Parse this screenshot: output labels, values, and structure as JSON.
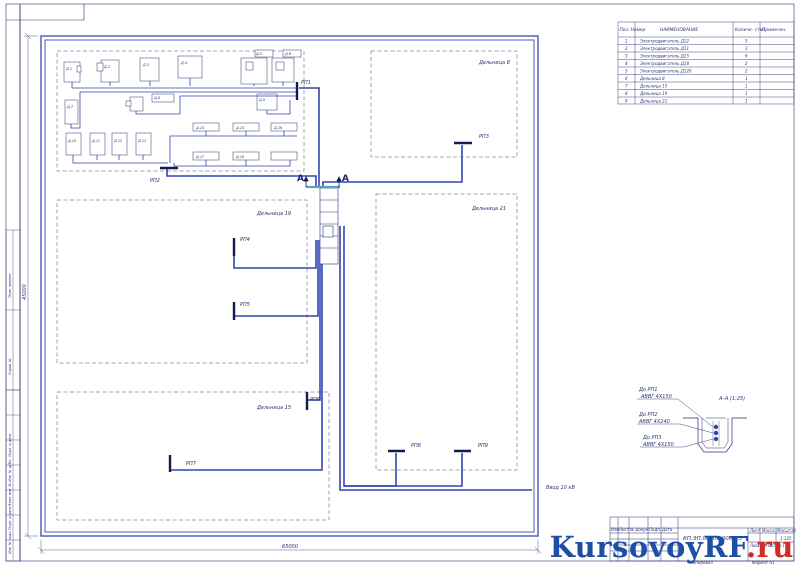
{
  "zones": {
    "z8": "Дельница 8",
    "z19": "Дельница 19",
    "z21": "Дельница 21",
    "z15": "Дельница 15"
  },
  "dist_points": {
    "rp1": "РП1",
    "rp2": "РП2",
    "rp3": "РП3",
    "rp4": "РП4",
    "rp5": "РП5",
    "rp6": "РП6",
    "rp7": "РП7",
    "rp8": "РП8",
    "rp9": "РП9"
  },
  "section_mark": "А",
  "input_label": "Ввод 10 кВ",
  "dimensions": {
    "width": "65000",
    "height": "45000"
  },
  "legend": {
    "headers": [
      "Поз. Номер",
      "НАИМЕНОВАНИЕ",
      "Количе- ство",
      "Примечан."
    ],
    "rows": [
      [
        "1",
        "Электродвигатель Д12",
        "5",
        ""
      ],
      [
        "2",
        "Электродвигатель Д11",
        "3",
        ""
      ],
      [
        "3",
        "Электродвигатель Д15",
        "6",
        ""
      ],
      [
        "4",
        "Электродвигатель Д18",
        "2",
        ""
      ],
      [
        "5",
        "Электродвигатель Д120",
        "2",
        ""
      ],
      [
        "6",
        "Дельница 8",
        "1",
        ""
      ],
      [
        "7",
        "Дельница 15",
        "1",
        ""
      ],
      [
        "8",
        "Дельница 19",
        "1",
        ""
      ],
      [
        "9",
        "Дельница 21",
        "1",
        ""
      ]
    ]
  },
  "section": {
    "title": "А–А (1:25)",
    "cables": [
      {
        "to": "До РП1",
        "cable": "АВВГ 4Х150"
      },
      {
        "to": "До РП2",
        "cable": "АВВГ 4Х240"
      },
      {
        "to": "До РП3",
        "cable": "АВВГ 4Х150"
      }
    ]
  },
  "title_block": {
    "doc_code": "КП.ЭП.00000.000.ПЭ",
    "sheet": "1",
    "sheets": "1",
    "scale": "1:125",
    "sheet_label": "Лист",
    "sheets_label": "Листов",
    "mass_label": "Масса",
    "scale_label": "Масштаб",
    "copied_label": "Копировал",
    "format_label": "Формат А1",
    "rows_labels": [
      "Изм.",
      "Лист",
      "№ докум.",
      "Подп.",
      "Дата"
    ]
  },
  "side_stamp": [
    "Инв. № подл.",
    "Подп. и дата",
    "Взам. инв. №",
    "Инв. № дубл.",
    "Подп. и дата",
    "Справ. №",
    "Перв. примен."
  ],
  "machines": [
    "Д-1",
    "Д-2",
    "Д-3",
    "Д-4",
    "Д-5",
    "Д-6",
    "Д-7",
    "Д-8",
    "Д-9",
    "Д-10",
    "Д-11",
    "Д-12",
    "Д-13",
    "Д-14",
    "Д-15",
    "Д-16",
    "Д-17",
    "Д-18"
  ],
  "watermark": {
    "main": "KursovoyRF",
    "suffix": ".ru"
  },
  "colors": {
    "line": "#3b4aa8",
    "cable": "#3344b0",
    "frame": "#2a3370",
    "bus": "#141a4a",
    "accent": "#5aa0c8"
  }
}
